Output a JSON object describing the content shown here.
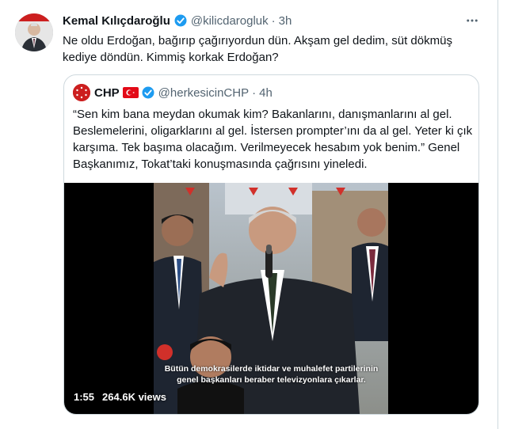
{
  "tweet": {
    "author_name": "Kemal Kılıçdaroğlu",
    "author_handle": "@kilicdarogluk",
    "separator": "·",
    "time": "3h",
    "text": "Ne oldu Erdoğan, bağırıp çağırıyordun dün. Akşam gel dedim, süt dökmüş kediye döndün. Kimmiş korkak Erdoğan?",
    "more_icon": "more-horizontal-icon",
    "verified_icon": "verified-badge-icon"
  },
  "quote": {
    "author_name": "CHP",
    "author_handle": "@herkesicinCHP",
    "separator": "·",
    "time": "4h",
    "flag_icon": "turkey-flag-icon",
    "text": "“Sen kim bana meydan okumak kim? Bakanlarını, danışmanlarını al gel. Beslemelerini, oligarklarını al gel. İstersen prompter’ını da al gel. Yeter ki çık karşıma. Tek başıma olacağım. Verilmeyecek hesabım yok benim.” Genel Başkanımız, Tokat’taki konuşmasında çağrısını yineledi.",
    "video": {
      "caption_line1": "Bütün demokrasilerde iktidar ve muhalefet partilerinin",
      "caption_line2": "genel başkanları beraber televizyonlara çıkarlar.",
      "duration": "1:55",
      "views": "264.6K views"
    }
  },
  "colors": {
    "accent": "#1d9bf0",
    "secondary_text": "#536471",
    "border": "#cfd9de",
    "chp_red": "#cc1f1f"
  }
}
